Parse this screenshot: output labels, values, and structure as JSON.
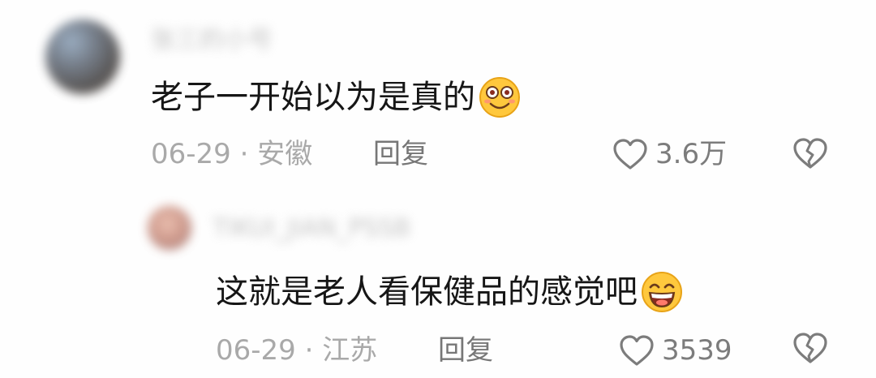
{
  "comments": [
    {
      "username": "张三的小号",
      "text": "老子一开始以为是真的",
      "emoji": "smiling-face-icon",
      "date": "06-29",
      "location": "安徽",
      "reply_label": "回复",
      "like_count": "3.6万"
    },
    {
      "username": "TIKUI_JIAN_PSSB",
      "text": "这就是老人看保健品的感觉吧",
      "emoji": "grinning-face-icon",
      "date": "06-29",
      "location": "江苏",
      "reply_label": "回复",
      "like_count": "3539"
    }
  ],
  "separator": "·",
  "colors": {
    "text_primary": "#161616",
    "text_secondary": "#a9a9a9",
    "icon_gray": "#7c7c7c",
    "emoji_yellow": "#ffc83d"
  }
}
